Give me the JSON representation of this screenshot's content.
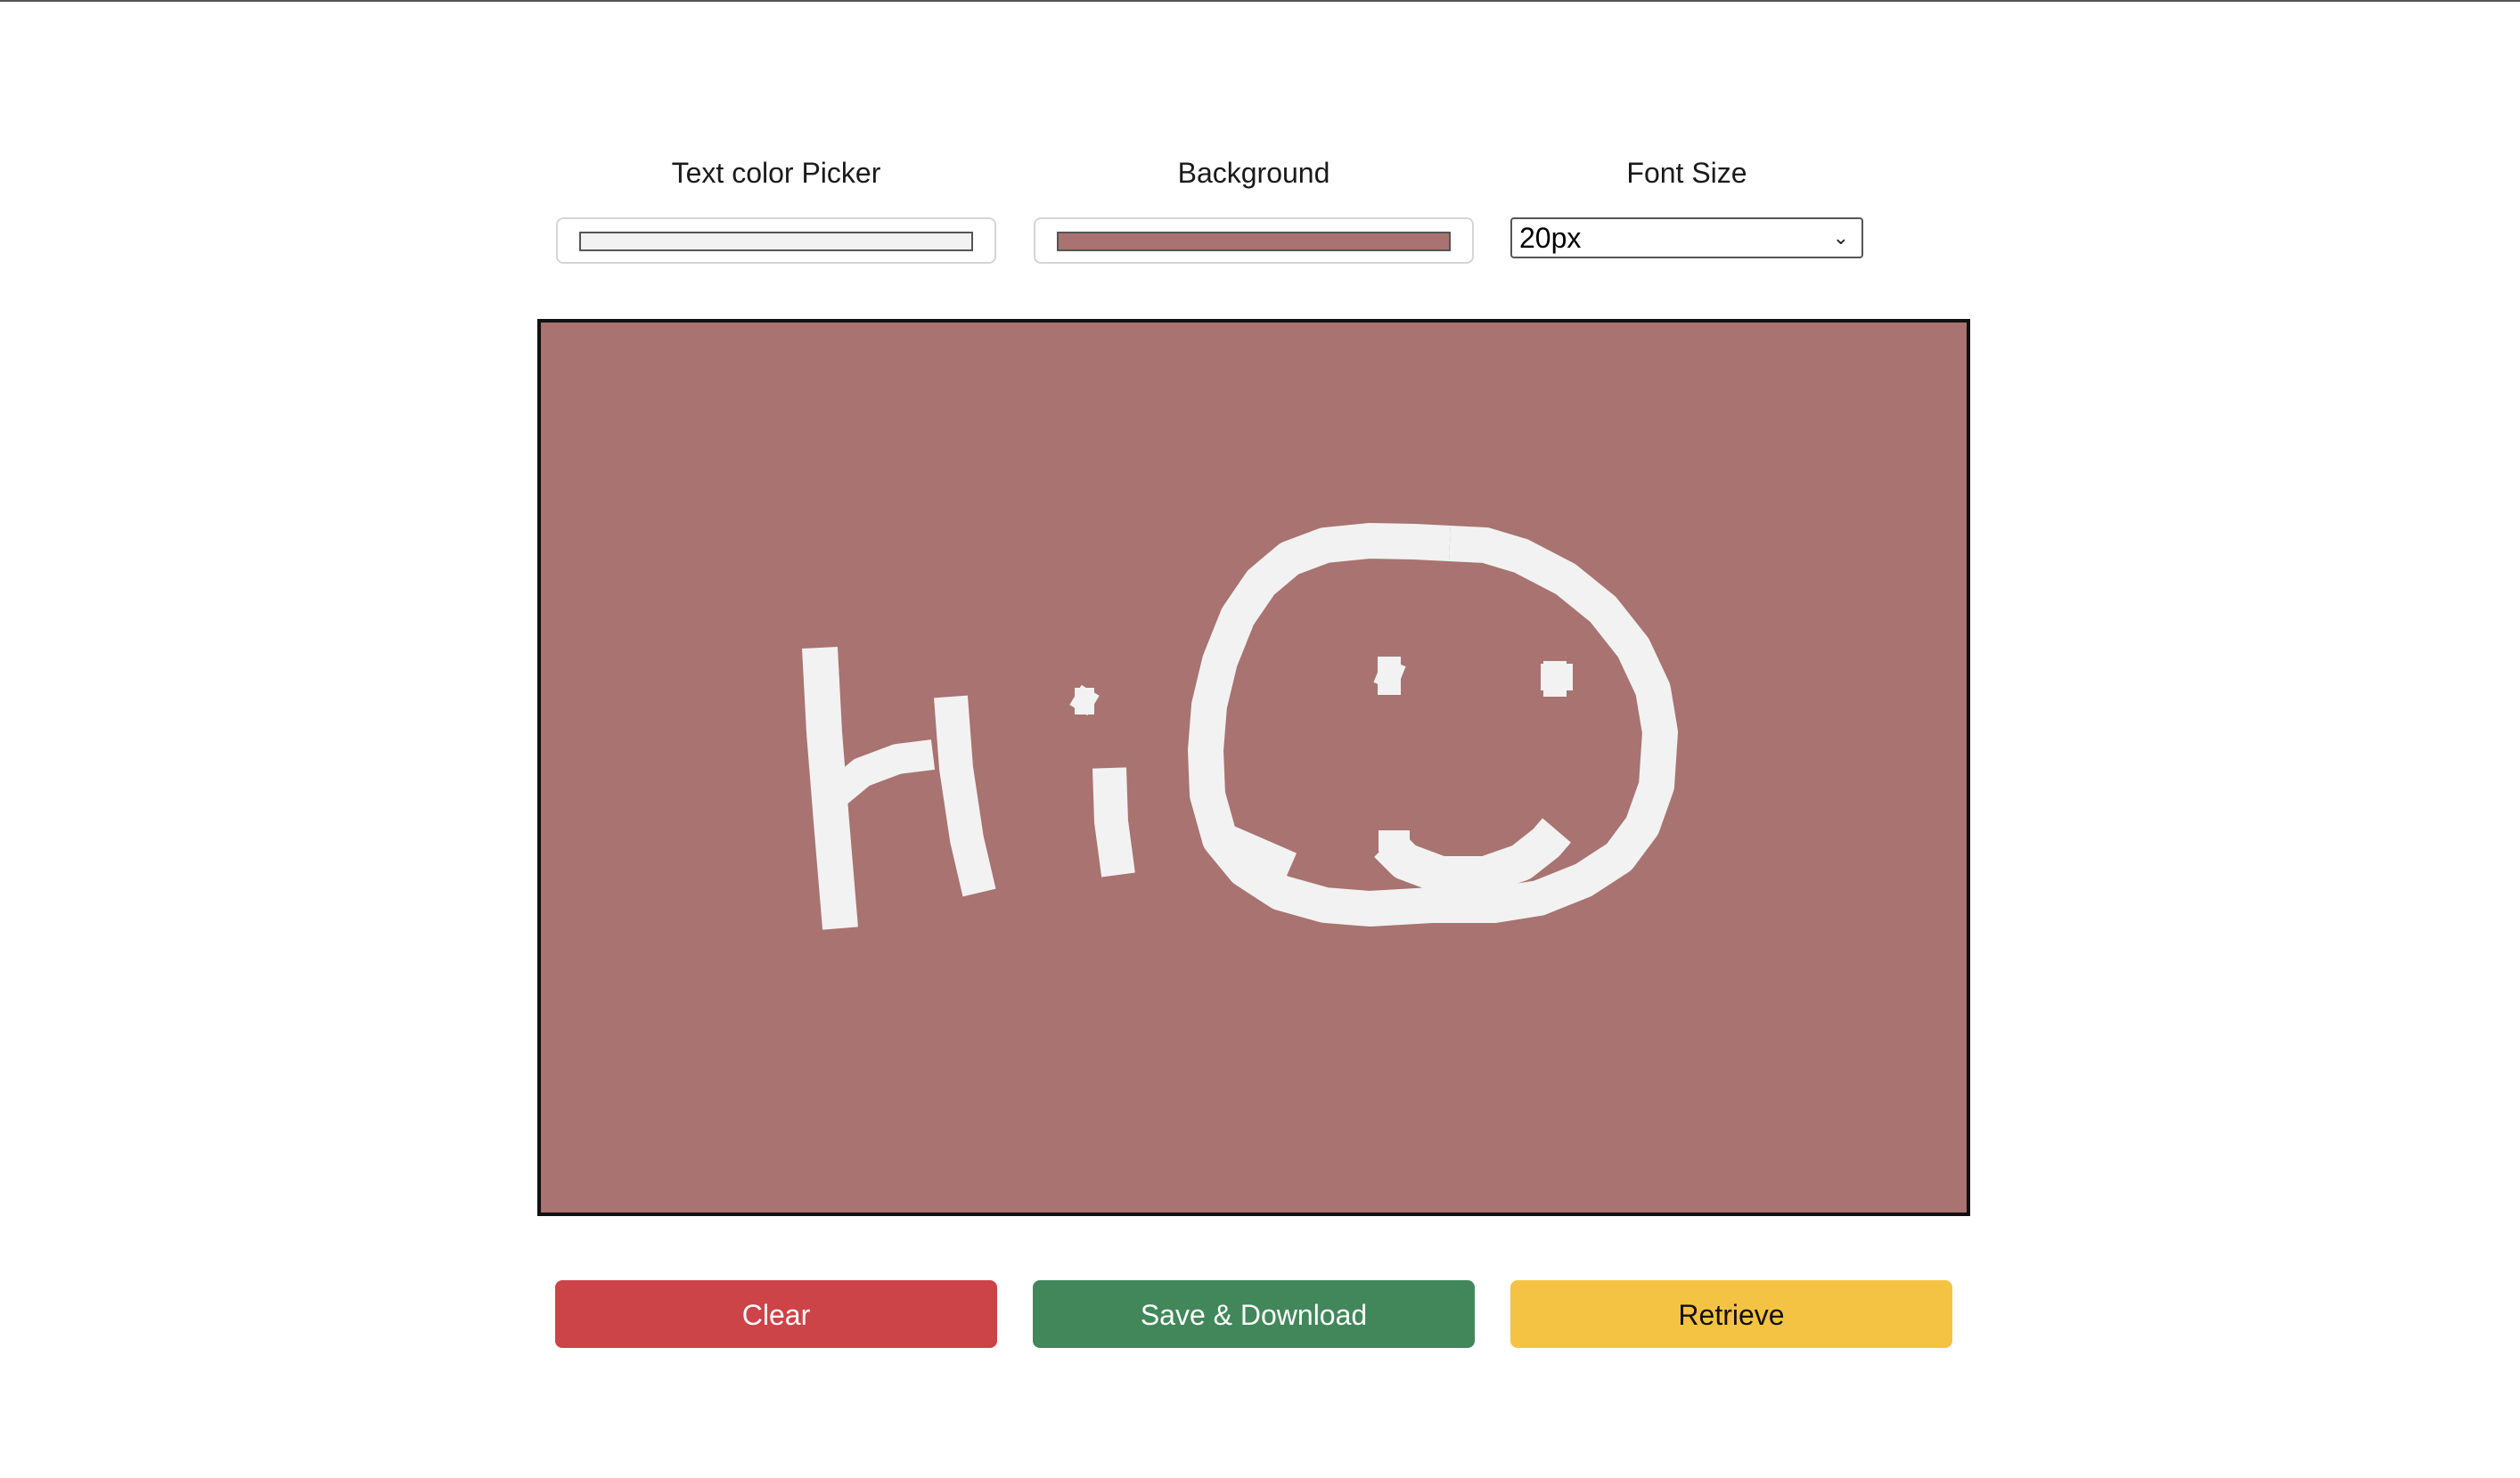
{
  "controls": {
    "text_color_label": "Text color Picker",
    "text_color_value": "#f2f2f2",
    "background_label": "Background",
    "background_value": "#a87370",
    "font_size_label": "Font Size",
    "font_size_value": "20px"
  },
  "canvas": {
    "background_color": "#a87370",
    "stroke_color": "#f2f2f2",
    "border_color": "#111111"
  },
  "buttons": {
    "clear_label": "Clear",
    "clear_color": "#cc4348",
    "save_label": "Save & Download",
    "save_color": "#41875a",
    "retrieve_label": "Retrieve",
    "retrieve_color": "#f4c343"
  },
  "icons": {
    "select_arrow": "chevron-down-icon"
  }
}
